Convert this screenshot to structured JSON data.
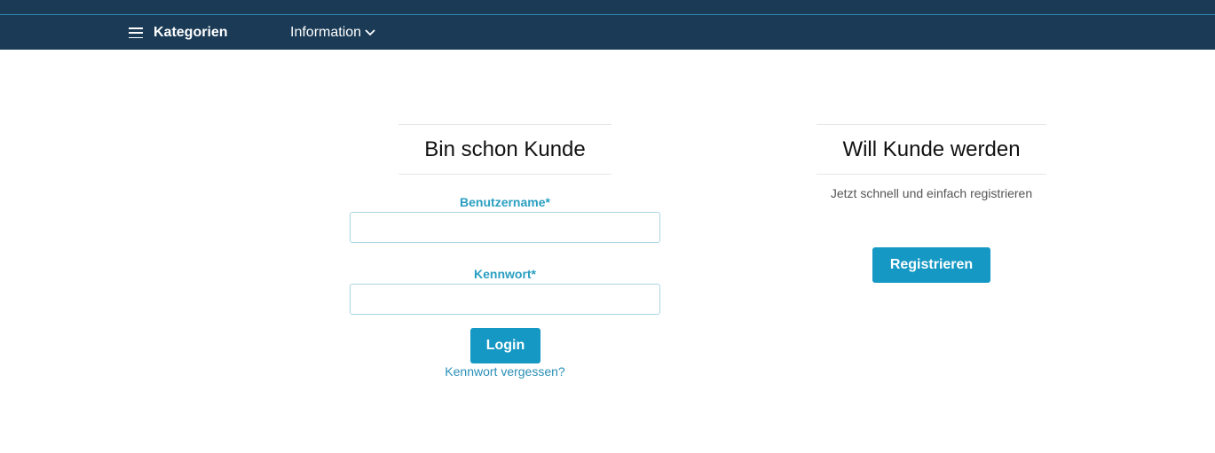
{
  "nav": {
    "categories_label": "Kategorien",
    "information_label": "Information"
  },
  "login": {
    "title": "Bin schon Kunde",
    "username_label": "Benutzername*",
    "username_value": "",
    "password_label": "Kennwort*",
    "password_value": "",
    "login_button": "Login",
    "forgot_link": "Kennwort vergessen?"
  },
  "register": {
    "title": "Will Kunde werden",
    "text": "Jetzt schnell und einfach registrieren",
    "register_button": "Registrieren"
  },
  "colors": {
    "nav_background": "#1a3a55",
    "accent": "#1598c4",
    "label_color": "#2a9fc1"
  },
  "icons": {
    "menu": "hamburger-menu-icon",
    "dropdown": "chevron-down-icon"
  }
}
